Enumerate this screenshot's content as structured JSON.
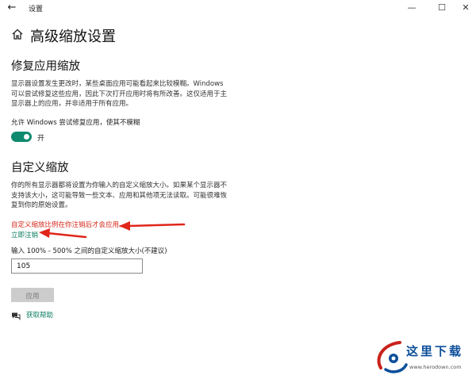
{
  "window": {
    "title": "设置",
    "minimize": "—",
    "maximize": "☐",
    "close": "✕"
  },
  "page": {
    "title": "高级缩放设置"
  },
  "fix_section": {
    "heading": "修复应用缩放",
    "desc_lines": [
      "显示器设置发生更改时，某些桌面应用可能看起来比较模糊。Windows",
      "可以尝试修复这些应用，因此下次打开应用时将有所改善。这仅适用于主",
      "显示器上的应用，并非适用于所有应用。"
    ],
    "toggle_label": "允许 Windows 尝试修复应用，使其不模糊",
    "toggle_state": "开",
    "toggle_on": true
  },
  "custom_section": {
    "heading": "自定义缩放",
    "desc_lines": [
      "你的所有显示器都将设置为你输入的自定义缩放大小。如果某个显示器不",
      "支持该大小，这可能导致一些文本、应用和其他项无法读取。可能很难恢",
      "复到你的原始设置。"
    ],
    "warning": "自定义缩放比例在你注销后才会应用。",
    "signout_link": "立即注销",
    "input_label": "输入 100% - 500% 之间的自定义缩放大小(不建议)",
    "input_value": "105",
    "apply_label": "应用"
  },
  "help": {
    "label": "获取帮助"
  },
  "watermark": {
    "main": "这里下载",
    "url": "www.herodown.com"
  },
  "colors": {
    "accent": "#0e8a6f",
    "link": "#0a7d5f",
    "warning": "#d6281c",
    "annotation_arrow": "#e0261b"
  }
}
